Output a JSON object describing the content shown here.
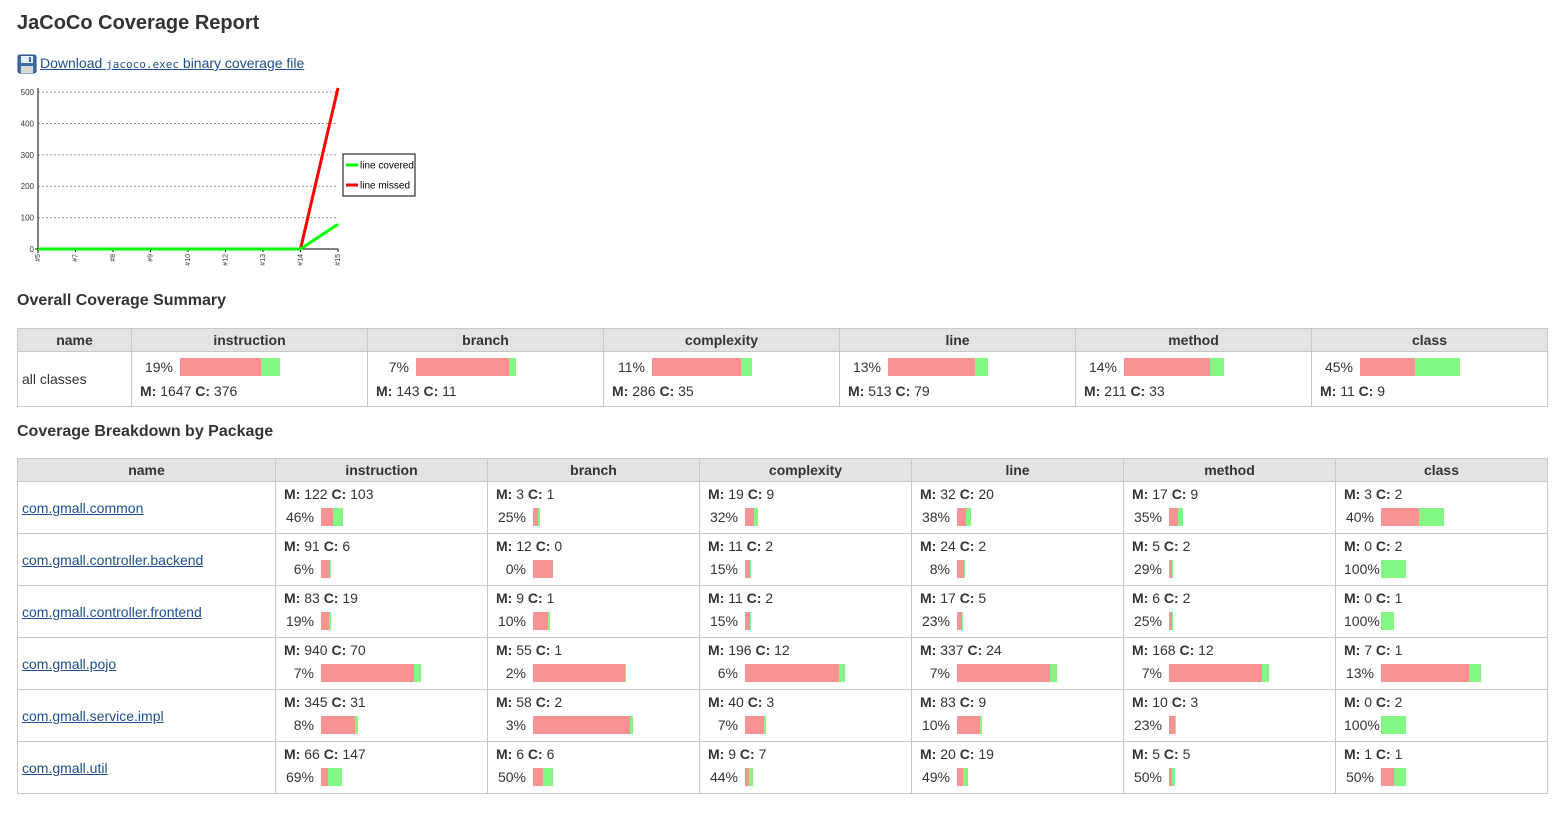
{
  "title": "JaCoCo Coverage Report",
  "download": {
    "prefix": "Download ",
    "file": "jacoco.exec",
    "suffix": " binary coverage file"
  },
  "chart_data": {
    "type": "line",
    "categories": [
      "#5",
      "#7",
      "#8",
      "#9",
      "#10",
      "#12",
      "#13",
      "#14",
      "#15"
    ],
    "series": [
      {
        "name": "line covered",
        "color": "#00ff00",
        "values": [
          0,
          0,
          0,
          0,
          0,
          0,
          0,
          0,
          79
        ]
      },
      {
        "name": "line missed",
        "color": "#ff0000",
        "values": [
          0,
          0,
          0,
          0,
          0,
          0,
          0,
          0,
          513
        ]
      }
    ],
    "yticks": [
      0,
      100,
      200,
      300,
      400,
      500
    ],
    "ylim": [
      0,
      513
    ],
    "grid": true,
    "legend": "right"
  },
  "summary": {
    "heading": "Overall Coverage Summary",
    "columns": [
      "name",
      "instruction",
      "branch",
      "complexity",
      "line",
      "method",
      "class"
    ],
    "row": {
      "name": "all classes",
      "cells": [
        {
          "pct": "19%",
          "missed": 1647,
          "covered": 376
        },
        {
          "pct": "7%",
          "missed": 143,
          "covered": 11
        },
        {
          "pct": "11%",
          "missed": 286,
          "covered": 35
        },
        {
          "pct": "13%",
          "missed": 513,
          "covered": 79
        },
        {
          "pct": "14%",
          "missed": 211,
          "covered": 33
        },
        {
          "pct": "45%",
          "missed": 11,
          "covered": 9
        }
      ]
    }
  },
  "breakdown": {
    "heading": "Coverage Breakdown by Package",
    "columns": [
      "name",
      "instruction",
      "branch",
      "complexity",
      "line",
      "method",
      "class"
    ],
    "rows": [
      {
        "name": "com.gmall.common",
        "cells": [
          {
            "pct": "46%",
            "missed": 122,
            "covered": 103
          },
          {
            "pct": "25%",
            "missed": 3,
            "covered": 1
          },
          {
            "pct": "32%",
            "missed": 19,
            "covered": 9
          },
          {
            "pct": "38%",
            "missed": 32,
            "covered": 20
          },
          {
            "pct": "35%",
            "missed": 17,
            "covered": 9
          },
          {
            "pct": "40%",
            "missed": 3,
            "covered": 2
          }
        ]
      },
      {
        "name": "com.gmall.controller.backend",
        "cells": [
          {
            "pct": "6%",
            "missed": 91,
            "covered": 6
          },
          {
            "pct": "0%",
            "missed": 12,
            "covered": 0
          },
          {
            "pct": "15%",
            "missed": 11,
            "covered": 2
          },
          {
            "pct": "8%",
            "missed": 24,
            "covered": 2
          },
          {
            "pct": "29%",
            "missed": 5,
            "covered": 2
          },
          {
            "pct": "100%",
            "missed": 0,
            "covered": 2
          }
        ]
      },
      {
        "name": "com.gmall.controller.frontend",
        "cells": [
          {
            "pct": "19%",
            "missed": 83,
            "covered": 19
          },
          {
            "pct": "10%",
            "missed": 9,
            "covered": 1
          },
          {
            "pct": "15%",
            "missed": 11,
            "covered": 2
          },
          {
            "pct": "23%",
            "missed": 17,
            "covered": 5
          },
          {
            "pct": "25%",
            "missed": 6,
            "covered": 2
          },
          {
            "pct": "100%",
            "missed": 0,
            "covered": 1
          }
        ]
      },
      {
        "name": "com.gmall.pojo",
        "cells": [
          {
            "pct": "7%",
            "missed": 940,
            "covered": 70
          },
          {
            "pct": "2%",
            "missed": 55,
            "covered": 1
          },
          {
            "pct": "6%",
            "missed": 196,
            "covered": 12
          },
          {
            "pct": "7%",
            "missed": 337,
            "covered": 24
          },
          {
            "pct": "7%",
            "missed": 168,
            "covered": 12
          },
          {
            "pct": "13%",
            "missed": 7,
            "covered": 1
          }
        ]
      },
      {
        "name": "com.gmall.service.impl",
        "cells": [
          {
            "pct": "8%",
            "missed": 345,
            "covered": 31
          },
          {
            "pct": "3%",
            "missed": 58,
            "covered": 2
          },
          {
            "pct": "7%",
            "missed": 40,
            "covered": 3
          },
          {
            "pct": "10%",
            "missed": 83,
            "covered": 9
          },
          {
            "pct": "23%",
            "missed": 10,
            "covered": 3
          },
          {
            "pct": "100%",
            "missed": 0,
            "covered": 2
          }
        ]
      },
      {
        "name": "com.gmall.util",
        "cells": [
          {
            "pct": "69%",
            "missed": 66,
            "covered": 147
          },
          {
            "pct": "50%",
            "missed": 6,
            "covered": 6
          },
          {
            "pct": "44%",
            "missed": 9,
            "covered": 7
          },
          {
            "pct": "49%",
            "missed": 20,
            "covered": 19
          },
          {
            "pct": "50%",
            "missed": 5,
            "covered": 5
          },
          {
            "pct": "50%",
            "missed": 1,
            "covered": 1
          }
        ]
      }
    ]
  },
  "labels": {
    "missed": "M:",
    "covered": "C:"
  },
  "colors": {
    "missed": "#f89393",
    "covered": "#83f783",
    "link": "#1d4f8a",
    "header_bg": "#e3e3e3"
  }
}
